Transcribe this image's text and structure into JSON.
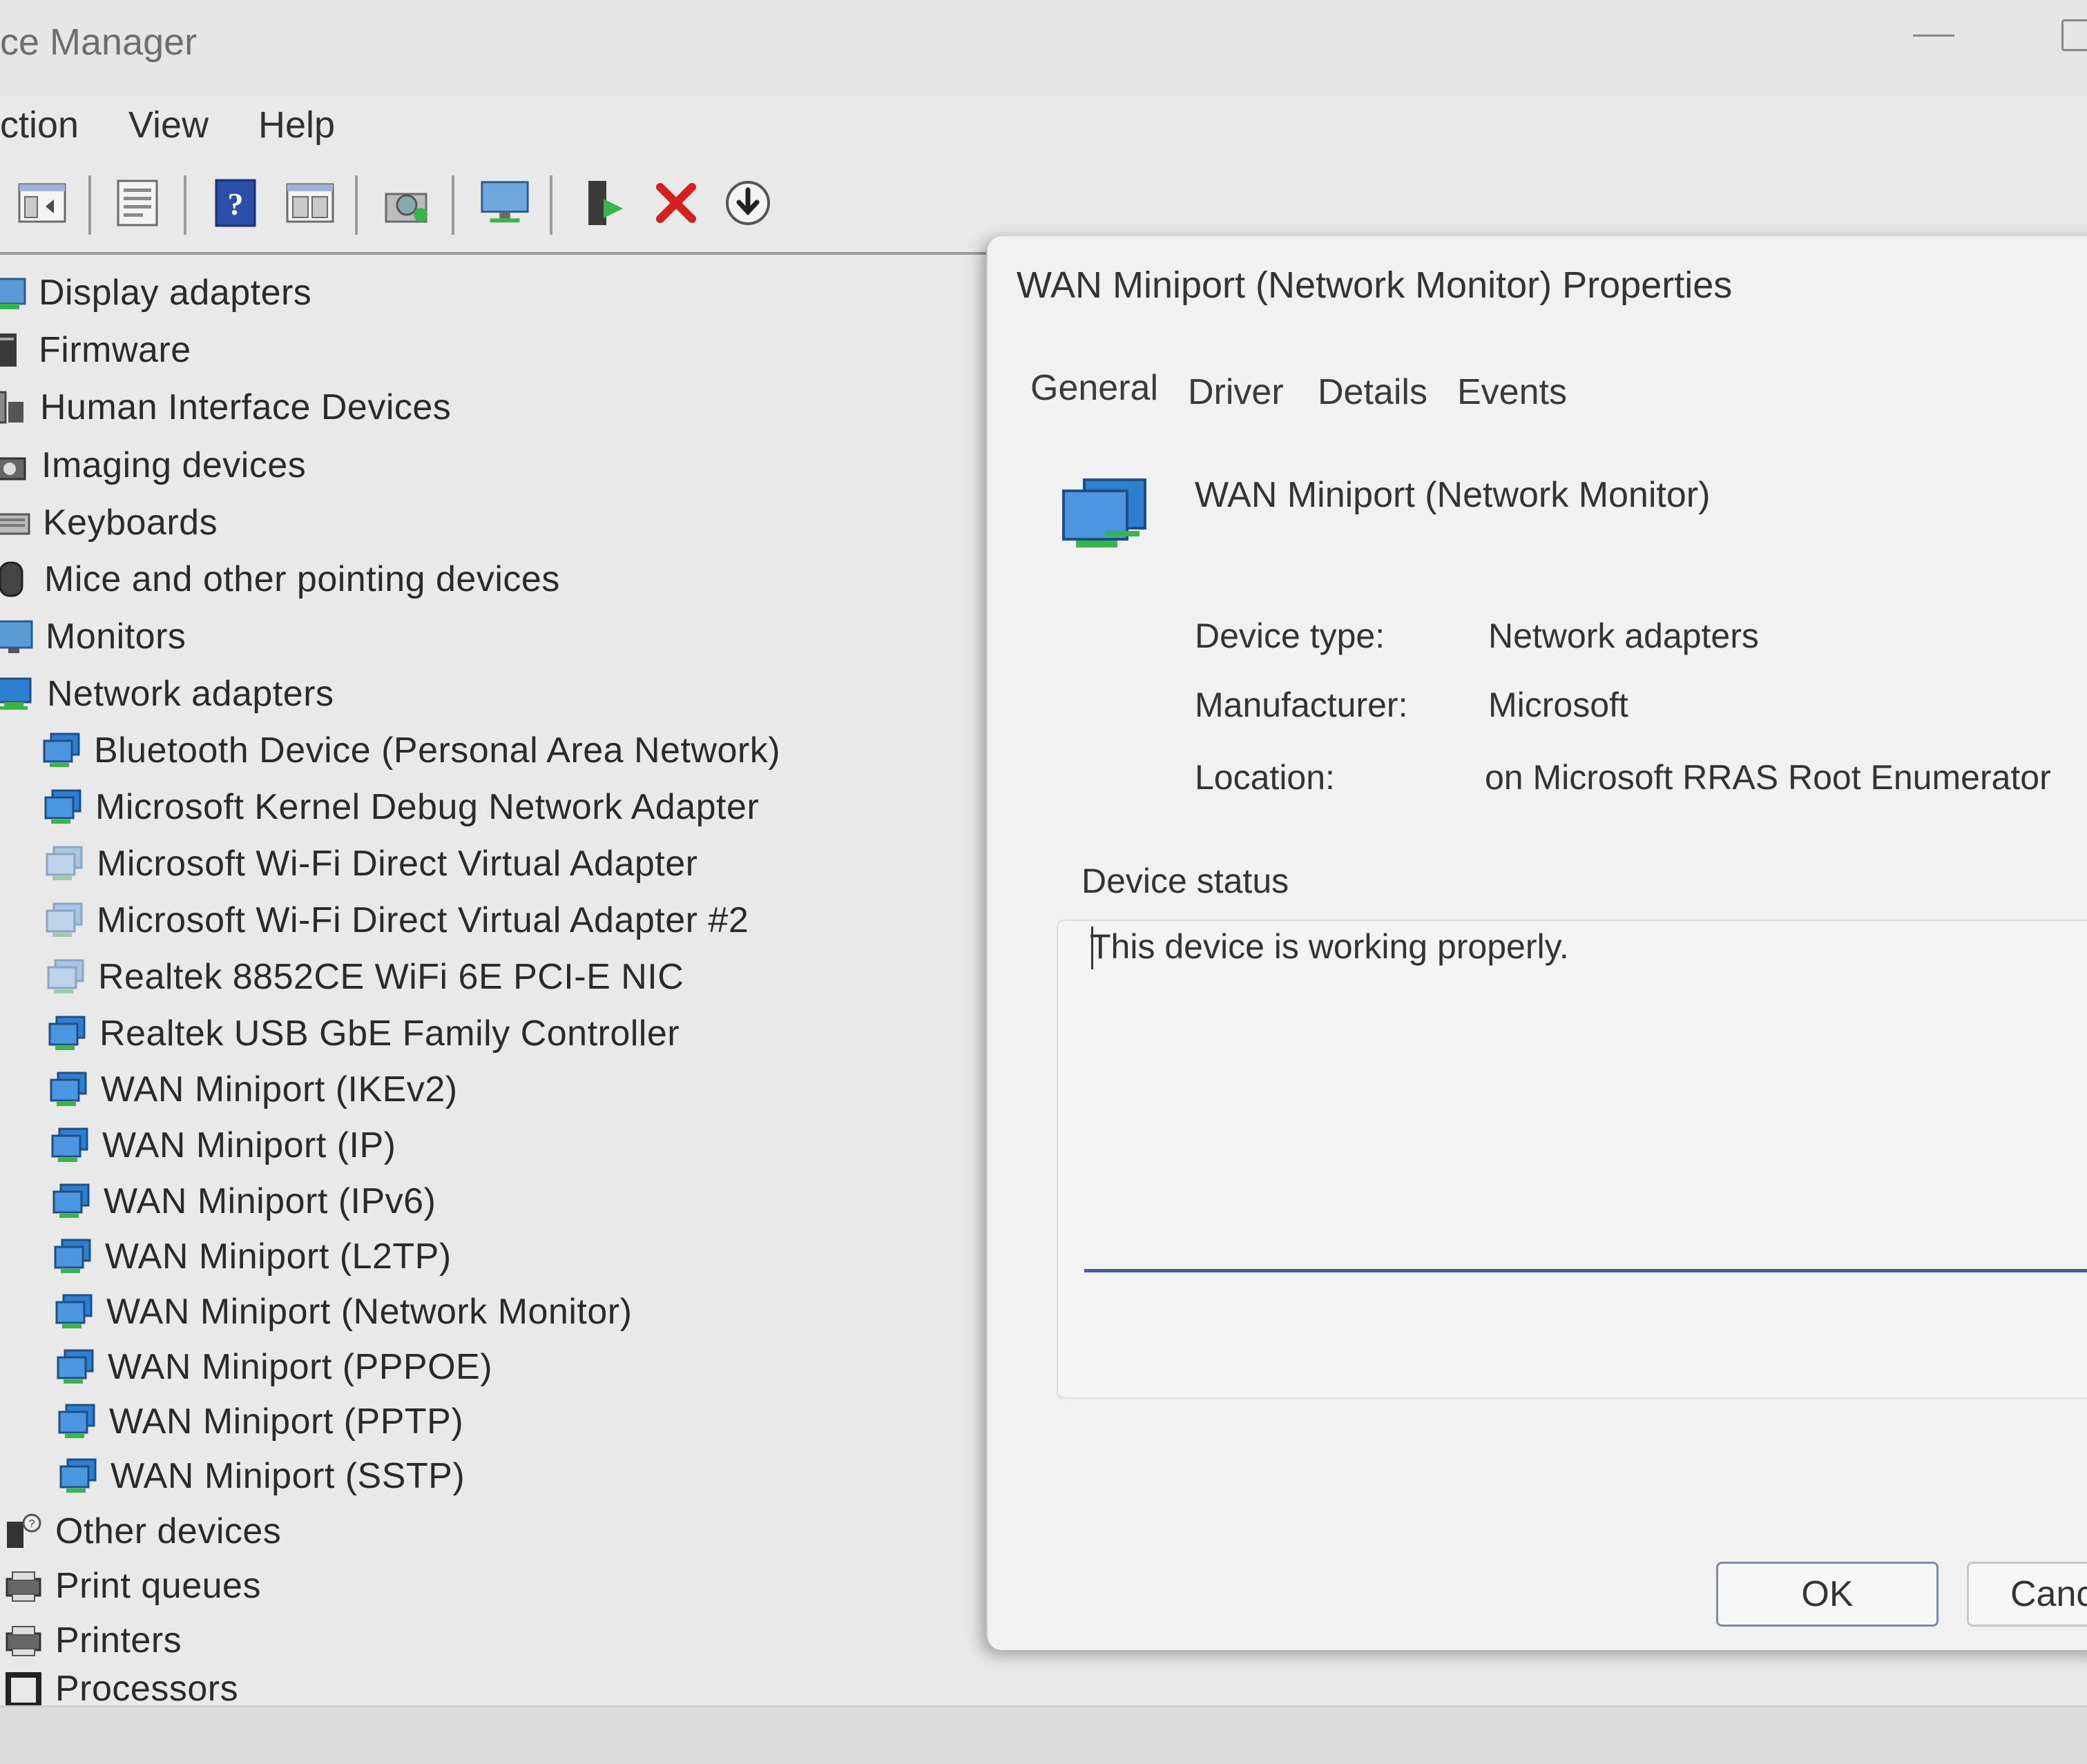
{
  "window": {
    "title": "ce Manager",
    "menu": [
      "ction",
      "View",
      "Help"
    ]
  },
  "toolbar_icons": [
    "back-icon",
    "properties-icon",
    "help-icon",
    "view-icon",
    "scan-hardware-icon",
    "monitor-icon",
    "update-driver-icon",
    "uninstall-icon",
    "download-icon"
  ],
  "tree": {
    "categories_top": [
      {
        "label": "Display adapters",
        "icon": "display-adapter-icon"
      },
      {
        "label": "Firmware",
        "icon": "firmware-icon"
      },
      {
        "label": "Human Interface Devices",
        "icon": "hid-icon"
      },
      {
        "label": "Imaging devices",
        "icon": "camera-icon"
      },
      {
        "label": "Keyboards",
        "icon": "keyboard-icon"
      },
      {
        "label": "Mice and other pointing devices",
        "icon": "mouse-icon"
      },
      {
        "label": "Monitors",
        "icon": "monitor-icon"
      },
      {
        "label": "Network adapters",
        "icon": "network-adapter-icon"
      }
    ],
    "network_children": [
      {
        "label": "Bluetooth Device (Personal Area Network)",
        "disabled": false
      },
      {
        "label": "Microsoft Kernel Debug Network Adapter",
        "disabled": false
      },
      {
        "label": "Microsoft Wi-Fi Direct Virtual Adapter",
        "disabled": true
      },
      {
        "label": "Microsoft Wi-Fi Direct Virtual Adapter #2",
        "disabled": true
      },
      {
        "label": "Realtek 8852CE WiFi 6E PCI-E NIC",
        "disabled": true
      },
      {
        "label": "Realtek USB GbE Family Controller",
        "disabled": false
      },
      {
        "label": "WAN Miniport (IKEv2)",
        "disabled": false
      },
      {
        "label": "WAN Miniport (IP)",
        "disabled": false
      },
      {
        "label": "WAN Miniport (IPv6)",
        "disabled": false
      },
      {
        "label": "WAN Miniport (L2TP)",
        "disabled": false
      },
      {
        "label": "WAN Miniport (Network Monitor)",
        "disabled": false
      },
      {
        "label": "WAN Miniport (PPPOE)",
        "disabled": false
      },
      {
        "label": "WAN Miniport (PPTP)",
        "disabled": false
      },
      {
        "label": "WAN Miniport (SSTP)",
        "disabled": false
      }
    ],
    "categories_bottom": [
      {
        "label": "Other devices",
        "icon": "other-devices-icon"
      },
      {
        "label": "Print queues",
        "icon": "print-queue-icon"
      },
      {
        "label": "Printers",
        "icon": "printer-icon"
      },
      {
        "label": "Processors",
        "icon": "processor-icon"
      }
    ]
  },
  "dialog": {
    "title": "WAN Miniport (Network Monitor) Properties",
    "tabs": [
      "General",
      "Driver",
      "Details",
      "Events"
    ],
    "device_name": "WAN Miniport (Network Monitor)",
    "props": {
      "device_type_label": "Device type:",
      "device_type_value": "Network adapters",
      "manufacturer_label": "Manufacturer:",
      "manufacturer_value": "Microsoft",
      "location_label": "Location:",
      "location_value": "on Microsoft RRAS Root Enumerator"
    },
    "status_heading": "Device status",
    "status_text": "This device is working properly.",
    "ok_label": "OK",
    "cancel_label": "Canc"
  },
  "colors": {
    "accent_blue": "#3f5aa6",
    "network_icon_blue": "#2f7fd0",
    "network_icon_green": "#38b44a",
    "uninstall_red": "#d42020"
  }
}
